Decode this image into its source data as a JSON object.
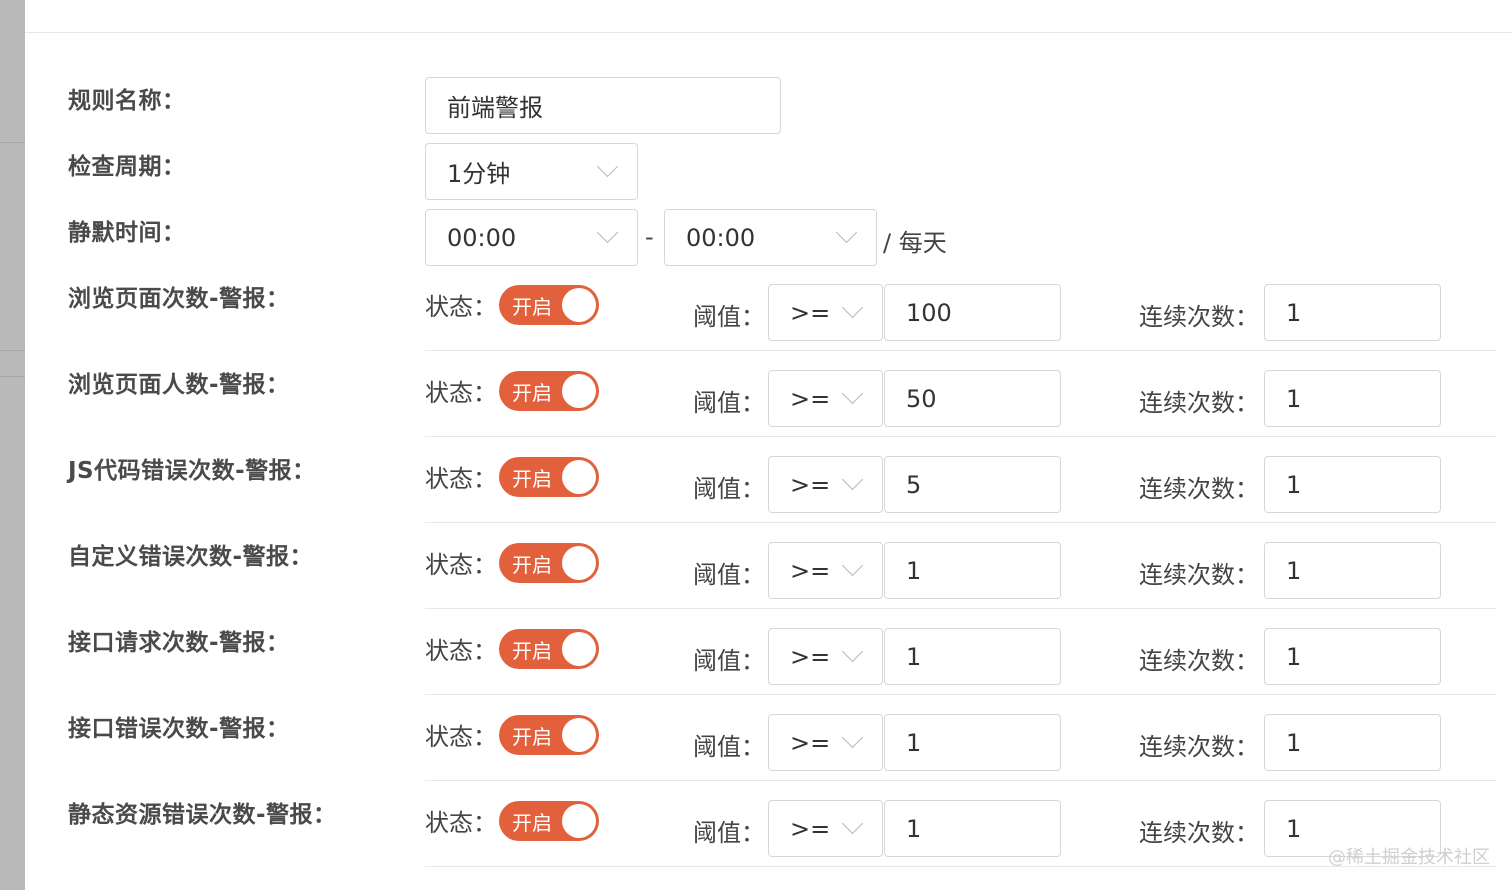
{
  "form": {
    "rule_name": {
      "label": "规则名称：",
      "value": "前端警报"
    },
    "check_period": {
      "label": "检查周期：",
      "value": "1分钟"
    },
    "silence_time": {
      "label": "静默时间：",
      "start": "00:00",
      "separator": "-",
      "end": "00:00",
      "suffix": "/ 每天"
    }
  },
  "labels": {
    "status": "状态：",
    "threshold": "阈值：",
    "consecutive": "连续次数："
  },
  "alerts": [
    {
      "name": "浏览页面次数-警报：",
      "toggle": "开启",
      "operator": ">=",
      "threshold": "100",
      "consecutive": "1"
    },
    {
      "name": "浏览页面人数-警报：",
      "toggle": "开启",
      "operator": ">=",
      "threshold": "50",
      "consecutive": "1"
    },
    {
      "name": "JS代码错误次数-警报：",
      "toggle": "开启",
      "operator": ">=",
      "threshold": "5",
      "consecutive": "1"
    },
    {
      "name": "自定义错误次数-警报：",
      "toggle": "开启",
      "operator": ">=",
      "threshold": "1",
      "consecutive": "1"
    },
    {
      "name": "接口请求次数-警报：",
      "toggle": "开启",
      "operator": ">=",
      "threshold": "1",
      "consecutive": "1"
    },
    {
      "name": "接口错误次数-警报：",
      "toggle": "开启",
      "operator": ">=",
      "threshold": "1",
      "consecutive": "1"
    },
    {
      "name": "静态资源错误次数-警报：",
      "toggle": "开启",
      "operator": ">=",
      "threshold": "1",
      "consecutive": "1"
    }
  ],
  "watermark": "@稀土掘金技术社区",
  "colors": {
    "toggle_on": "#e2613c",
    "border": "#d7d7d7",
    "label": "#4a4a4a"
  }
}
